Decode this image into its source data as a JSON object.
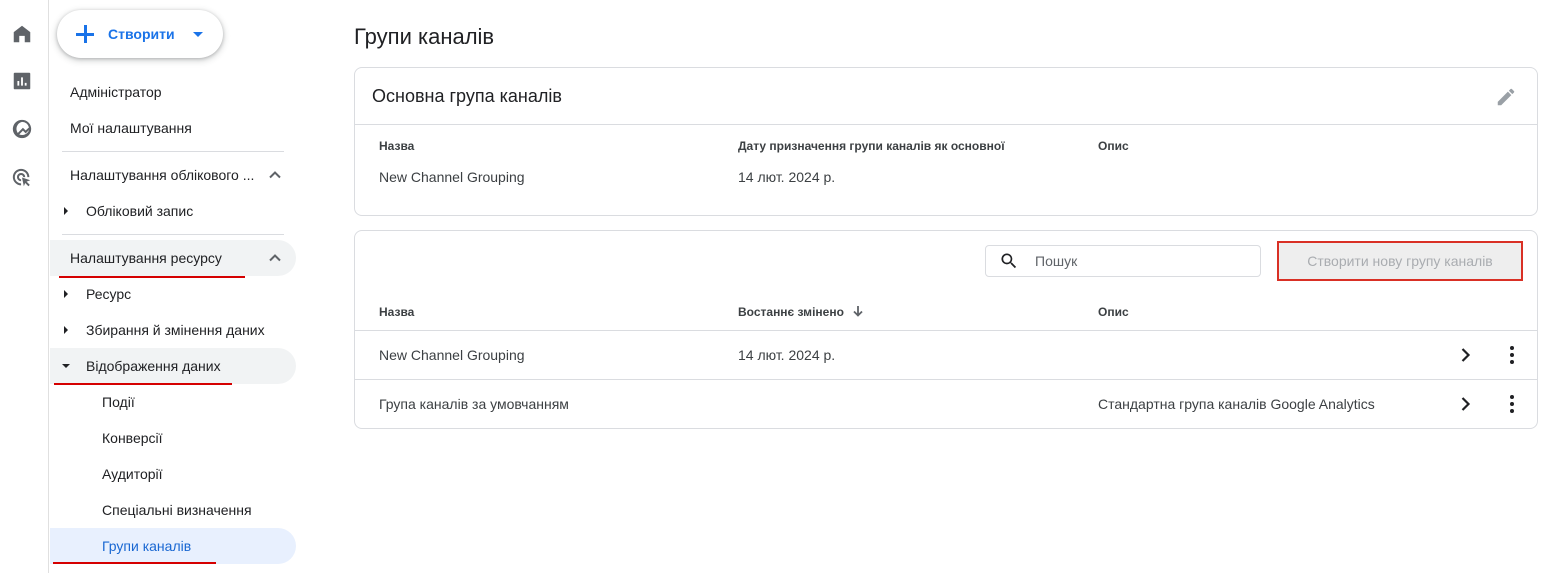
{
  "rail": {
    "icons": [
      "home-icon",
      "reports-icon",
      "explore-icon",
      "advertising-icon"
    ]
  },
  "nav": {
    "create_label": "Створити",
    "admin": "Адміністратор",
    "my_settings": "Мої налаштування",
    "account_settings_header": "Налаштування облікового ...",
    "account": "Обліковий запис",
    "property_settings_header": "Налаштування ресурсу",
    "property": "Ресурс",
    "data_collection": "Збирання й змінення даних",
    "data_display": "Відображення даних",
    "events": "Події",
    "conversions": "Конверсії",
    "audiences": "Аудиторії",
    "custom_definitions": "Спеціальні визначення",
    "channel_groups": "Групи каналів"
  },
  "main": {
    "title": "Групи каналів",
    "primary_card": {
      "title": "Основна група каналів",
      "col_name": "Назва",
      "col_date": "Дату призначення групи каналів як основної",
      "col_desc": "Опис",
      "name": "New Channel Grouping",
      "date": "14 лют. 2024 р.",
      "desc": ""
    },
    "list_card": {
      "search_placeholder": "Пошук",
      "new_button": "Створити нову групу каналів",
      "col_name": "Назва",
      "col_modified": "Востаннє змінено",
      "col_desc": "Опис",
      "rows": [
        {
          "name": "New Channel Grouping",
          "modified": "14 лют. 2024 р.",
          "desc": ""
        },
        {
          "name": "Група каналів за умовчанням",
          "modified": "",
          "desc": "Стандартна група каналів Google Analytics"
        }
      ]
    }
  },
  "colors": {
    "accent": "#1a73e8",
    "annotation_red": "#d50000",
    "selected_bg": "#e8f0fe"
  }
}
